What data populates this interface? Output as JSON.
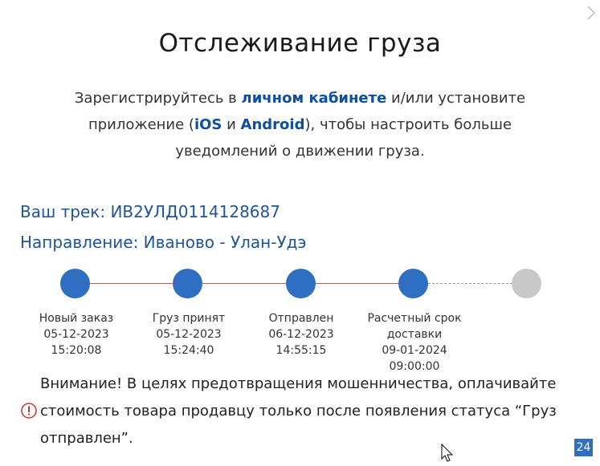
{
  "header": {
    "title": "Отслеживание груза"
  },
  "intro": {
    "part1": "Зарегистрируйтесь в ",
    "link_cabinet": "личном кабинете",
    "part2": " и/или установите приложение (",
    "link_ios": "iOS",
    "part3": " и ",
    "link_android": "Android",
    "part4": "), чтобы настроить больше уведомлений о движении груза."
  },
  "shipment": {
    "track": "Ваш трек: ИВ2УЛД0114128687",
    "direction": "Направление: Иваново - Улан-Удэ"
  },
  "timeline": {
    "steps": [
      {
        "label": "Новый заказ",
        "date": "05-12-2023",
        "time": "15:20:08",
        "status": "done"
      },
      {
        "label": "Груз принят",
        "date": "05-12-2023",
        "time": "15:24:40",
        "status": "done"
      },
      {
        "label": "Отправлен",
        "date": "06-12-2023",
        "time": "14:55:15",
        "status": "done"
      },
      {
        "label_line1": "Расчетный срок",
        "label_line2": "доставки",
        "date": "09-01-2024",
        "time": "09:00:00",
        "status": "done"
      },
      {
        "status": "pending"
      }
    ]
  },
  "warning": {
    "icon": "info-circle-icon",
    "text": "Внимание! В целях предотвращения мошенничества, оплачивайте стоимость товара продавцу только после появления статуса “Груз отправлен”."
  },
  "badge": {
    "text": "24"
  },
  "colors": {
    "accent": "#2e6fc1",
    "link": "#0b4ea2",
    "line_done": "#d9534f",
    "pending": "#c8c8c8",
    "warning_icon": "#d32f2f"
  }
}
